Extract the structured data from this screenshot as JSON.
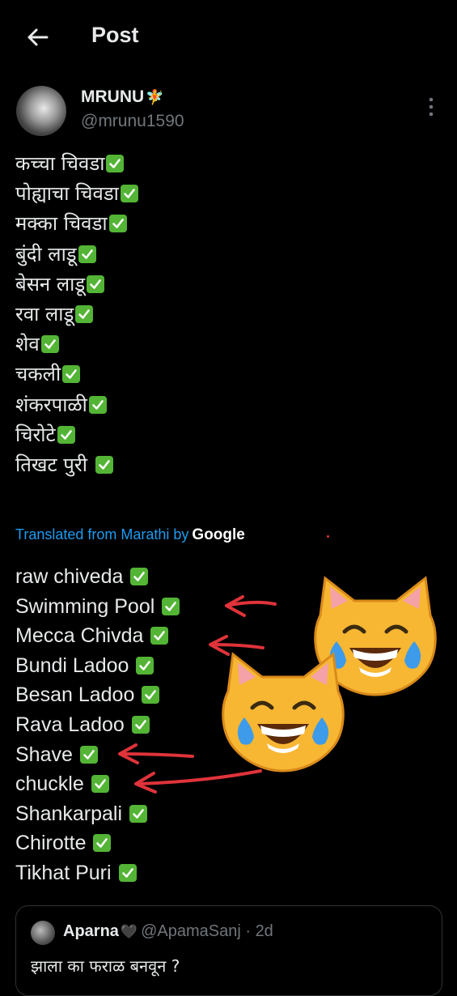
{
  "header": {
    "title": "Post",
    "back_icon": "arrow-left-icon"
  },
  "post": {
    "author": {
      "display_name": "MRUNU",
      "name_emoji": "🧚",
      "handle": "@mrunu1590"
    },
    "marathi_lines": [
      "कच्चा चिवडा",
      "पोह्याचा चिवडा",
      "मक्का चिवडा",
      "बुंदी लाडू",
      "बेसन लाडू",
      "रवा लाडू",
      "शेव",
      "चकली",
      "शंकरपाळी",
      "चिरोटे",
      "तिखट पुरी "
    ],
    "translation": {
      "label": "Translated from Marathi by",
      "provider": "Google"
    },
    "english_lines": [
      "raw chiveda ",
      "Swimming Pool ",
      "Mecca Chivda ",
      "Bundi Ladoo ",
      "Besan Ladoo ",
      "Rava Ladoo ",
      "Shave ",
      "chuckle ",
      "Shankarpali ",
      "Chirotte ",
      "Tikhat Puri "
    ],
    "check_icon": "check-mark-button-icon",
    "annotation": {
      "arrow_color": "#e0333a",
      "emoji": "cat-face-with-tears-of-joy-icon"
    }
  },
  "quote": {
    "name": "Aparna",
    "heart": "🖤",
    "handle": "@ApamaSanj",
    "time": "2d",
    "text": "झाला का फराळ बनवून ?"
  },
  "colors": {
    "background": "#000000",
    "text": "#e7e9ea",
    "secondary": "#71767b",
    "link": "#1d9bf0",
    "check": "#53b435"
  }
}
